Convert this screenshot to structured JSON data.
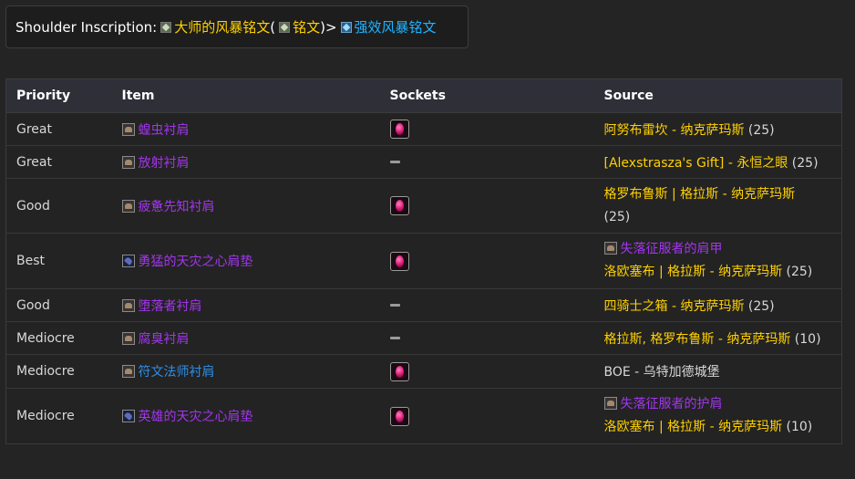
{
  "inscription": {
    "label": "Shoulder Inscription",
    "colon": ":",
    "icon1": "inscription-icon",
    "name": "大师的风暴铭文",
    "paren_open": " (",
    "profession": "铭文",
    "paren_close": ")",
    "arrow": " > ",
    "upgrade_icon": "inscription-blue-icon",
    "upgrade": "强效风暴铭文"
  },
  "table": {
    "headers": [
      "Priority",
      "Item",
      "Sockets",
      "Source"
    ],
    "rows": [
      {
        "priority": "Great",
        "item": "蝗虫衬肩",
        "socket": "gem",
        "source_lines": [
          {
            "text": "阿努布雷坎 - 纳克萨玛斯",
            "suffix": " (25)"
          }
        ]
      },
      {
        "priority": "Great",
        "item": "放射衬肩",
        "socket": "none",
        "source_lines": [
          {
            "text": "[Alexstrasza's Gift] - 永恒之眼",
            "suffix": " (25)"
          }
        ]
      },
      {
        "priority": "Good",
        "item": "疲惫先知衬肩",
        "socket": "gem",
        "source_lines": [
          {
            "text": "格罗布鲁斯 | 格拉斯 - 纳克萨玛斯",
            "suffix": ""
          },
          {
            "text": "",
            "suffix": "(25)"
          }
        ]
      },
      {
        "priority": "Best",
        "item": "勇猛的天灾之心肩垫",
        "socket": "gem",
        "source_token": "失落征服者的肩甲",
        "source_lines": [
          {
            "text": "洛欧塞布 | 格拉斯 - 纳克萨玛斯",
            "suffix": " (25)"
          }
        ]
      },
      {
        "priority": "Good",
        "item": "堕落者衬肩",
        "socket": "none",
        "source_lines": [
          {
            "text": "四骑士之箱 - 纳克萨玛斯",
            "suffix": " (25)"
          }
        ]
      },
      {
        "priority": "Mediocre",
        "item": "腐臭衬肩",
        "socket": "none",
        "source_lines": [
          {
            "text": "格拉斯, 格罗布鲁斯 - 纳克萨玛斯",
            "suffix": " (10)"
          }
        ]
      },
      {
        "priority": "Mediocre",
        "item": "符文法师衬肩",
        "socket": "gem",
        "rare": true,
        "source_lines": [
          {
            "text": "",
            "suffix": "BOE - 乌特加德城堡"
          }
        ]
      },
      {
        "priority": "Mediocre",
        "item": "英雄的天灾之心肩垫",
        "socket": "gem",
        "source_token": "失落征服者的护肩",
        "source_lines": [
          {
            "text": "洛欧塞布 | 格拉斯 - 纳克萨玛斯",
            "suffix": " (10)"
          }
        ]
      }
    ]
  },
  "colors": {
    "epic": "#a335ee",
    "rare": "#2e8fe8",
    "gold": "#ffd100",
    "header_bg": "#2e2f37"
  }
}
